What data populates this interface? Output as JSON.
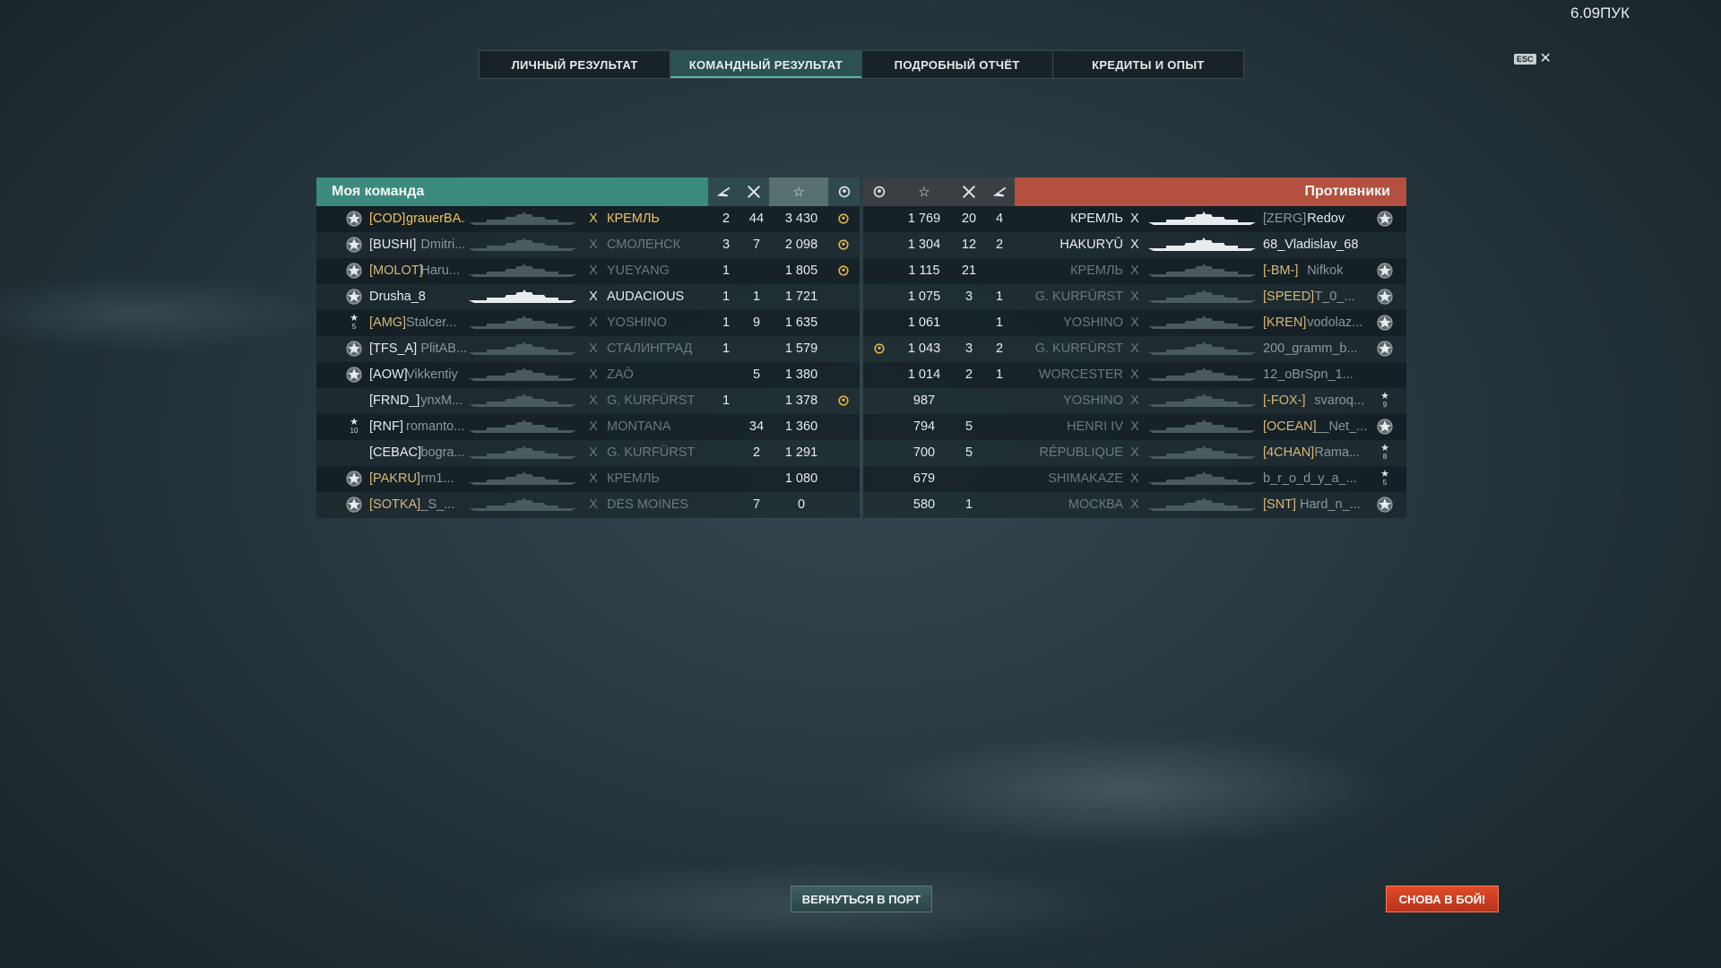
{
  "version": "6.09ПУК",
  "tabs": [
    {
      "label": "ЛИЧНЫЙ РЕЗУЛЬТАТ"
    },
    {
      "label": "КОМАНДНЫЙ РЕЗУЛЬТАТ"
    },
    {
      "label": "ПОДРОБНЫЙ ОТЧЁТ"
    },
    {
      "label": "КРЕДИТЫ И ОПЫТ"
    }
  ],
  "esc": {
    "key": "ESC",
    "close": "✕"
  },
  "my_team": {
    "title": "Моя команда",
    "rows": [
      {
        "clan": "[COD]",
        "name": "grauerBA...",
        "tier": "X",
        "ship": "КРЕМЛЬ",
        "planes": "2",
        "kills": "44",
        "xp": "3 430",
        "medal": true,
        "style": "hl",
        "rank": "star"
      },
      {
        "clan": "[BUSHI]",
        "name": "Dmitri...",
        "tier": "X",
        "ship": "СМОЛЕНСК",
        "planes": "3",
        "kills": "7",
        "xp": "2 098",
        "medal": true,
        "style": "dim",
        "rank": "star"
      },
      {
        "clan": "[MOLOT]",
        "name": "Haru...",
        "tier": "X",
        "ship": "YUEYANG",
        "planes": "1",
        "kills": "",
        "xp": "1 805",
        "medal": true,
        "style": "dim",
        "rank": "star"
      },
      {
        "clan": "",
        "name": "Drusha_8",
        "tier": "X",
        "ship": "AUDACIOUS",
        "planes": "1",
        "kills": "1",
        "xp": "1 721",
        "medal": false,
        "style": "white",
        "rank": "star"
      },
      {
        "clan": "[AMG]",
        "name": "Stalcer...",
        "tier": "X",
        "ship": "YOSHINO",
        "planes": "1",
        "kills": "9",
        "xp": "1 635",
        "medal": false,
        "style": "dim",
        "rank": "small",
        "rank_num": "5"
      },
      {
        "clan": "[TFS_A]",
        "name": "PlitAB...",
        "tier": "X",
        "ship": "СТАЛИНГРАД",
        "planes": "1",
        "kills": "",
        "xp": "1 579",
        "medal": false,
        "style": "dim",
        "rank": "star"
      },
      {
        "clan": "[AOW]",
        "name": "Vikkentiy",
        "tier": "X",
        "ship": "ZAŌ",
        "planes": "",
        "kills": "5",
        "xp": "1 380",
        "medal": false,
        "style": "dim",
        "rank": "star"
      },
      {
        "clan": "[FRND_]",
        "name": "ynxM...",
        "tier": "X",
        "ship": "G. KURFÜRST",
        "planes": "1",
        "kills": "",
        "xp": "1 378",
        "medal": true,
        "style": "dim",
        "rank": "none"
      },
      {
        "clan": "[RNF]",
        "name": "romanto...",
        "tier": "X",
        "ship": "MONTANA",
        "planes": "",
        "kills": "34",
        "xp": "1 360",
        "medal": false,
        "style": "dim",
        "rank": "small",
        "rank_num": "10"
      },
      {
        "clan": "[CEBAC]",
        "name": "bogra...",
        "tier": "X",
        "ship": "G. KURFÜRST",
        "planes": "",
        "kills": "2",
        "xp": "1 291",
        "medal": false,
        "style": "dim",
        "rank": "none"
      },
      {
        "clan": "[PAKRU]",
        "name": "rm1...",
        "tier": "X",
        "ship": "КРЕМЛЬ",
        "planes": "",
        "kills": "",
        "xp": "1 080",
        "medal": false,
        "style": "dim",
        "rank": "star"
      },
      {
        "clan": "[SOTKA]",
        "name": "_S_...",
        "tier": "X",
        "ship": "DES MOINES",
        "planes": "",
        "kills": "7",
        "xp": "0",
        "medal": false,
        "style": "dim",
        "rank": "star"
      }
    ]
  },
  "enemy_team": {
    "title": "Противники",
    "rows": [
      {
        "medal": false,
        "xp": "1 769",
        "kills": "20",
        "planes": "4",
        "ship": "КРЕМЛЬ",
        "tier": "X",
        "clan": "[ZERG]",
        "name": "Redov",
        "style": "white",
        "rank": "star"
      },
      {
        "medal": false,
        "xp": "1 304",
        "kills": "12",
        "planes": "2",
        "ship": "HAKURYŪ",
        "tier": "X",
        "clan": "",
        "name": "68_Vladislav_68",
        "style": "white",
        "rank": "none"
      },
      {
        "medal": false,
        "xp": "1 115",
        "kills": "21",
        "planes": "",
        "ship": "КРЕМЛЬ",
        "tier": "X",
        "clan": "[-BM-]",
        "name": "Nifkok",
        "style": "dim",
        "rank": "star"
      },
      {
        "medal": false,
        "xp": "1 075",
        "kills": "3",
        "planes": "1",
        "ship": "G. KURFÜRST",
        "tier": "X",
        "clan": "[SPEED]",
        "name": "T_0_...",
        "style": "dim",
        "rank": "star"
      },
      {
        "medal": false,
        "xp": "1 061",
        "kills": "",
        "planes": "1",
        "ship": "YOSHINO",
        "tier": "X",
        "clan": "[KREN]",
        "name": "vodolaz...",
        "style": "dim",
        "rank": "star"
      },
      {
        "medal": true,
        "xp": "1 043",
        "kills": "3",
        "planes": "2",
        "ship": "G. KURFÜRST",
        "tier": "X",
        "clan": "",
        "name": "200_gramm_b...",
        "style": "dim",
        "rank": "star"
      },
      {
        "medal": false,
        "xp": "1 014",
        "kills": "2",
        "planes": "1",
        "ship": "WORCESTER",
        "tier": "X",
        "clan": "",
        "name": "12_oBrSpn_1...",
        "style": "dim",
        "rank": "none"
      },
      {
        "medal": false,
        "xp": "987",
        "kills": "",
        "planes": "",
        "ship": "YOSHINO",
        "tier": "X",
        "clan": "[-FOX-]",
        "name": "svaroq...",
        "style": "dim",
        "rank": "small",
        "rank_num": "9"
      },
      {
        "medal": false,
        "xp": "794",
        "kills": "5",
        "planes": "",
        "ship": "HENRI IV",
        "tier": "X",
        "clan": "[OCEAN]",
        "name": "__Net_...",
        "style": "dim",
        "rank": "star"
      },
      {
        "medal": false,
        "xp": "700",
        "kills": "5",
        "planes": "",
        "ship": "RÉPUBLIQUE",
        "tier": "X",
        "clan": "[4CHAN]",
        "name": "Rama...",
        "style": "dim",
        "rank": "small",
        "rank_num": "8"
      },
      {
        "medal": false,
        "xp": "679",
        "kills": "",
        "planes": "",
        "ship": "SHIMAKAZE",
        "tier": "X",
        "clan": "",
        "name": "b_r_o_d_y_a_...",
        "style": "dim",
        "rank": "small",
        "rank_num": "5"
      },
      {
        "medal": false,
        "xp": "580",
        "kills": "1",
        "planes": "",
        "ship": "МОСКВА",
        "tier": "X",
        "clan": "[SNT]",
        "name": "Hard_n_...",
        "style": "dim",
        "rank": "star"
      }
    ]
  },
  "buttons": {
    "port": "ВЕРНУТЬСЯ В ПОРТ",
    "again": "СНОВА В БОЙ!"
  },
  "colors": {
    "my_team": "#3c8a7e",
    "enemy": "#b4503f",
    "highlight": "#f2c35a",
    "clan": "#d8b77a",
    "again_button": "#d63e22"
  },
  "icons": {
    "planes": "plane-icon",
    "kills": "crossed-swords-icon",
    "xp": "star-icon",
    "medal": "laurel-medal-icon",
    "rank": "rank-star-icon",
    "ship": "ship-silhouette-icon"
  }
}
